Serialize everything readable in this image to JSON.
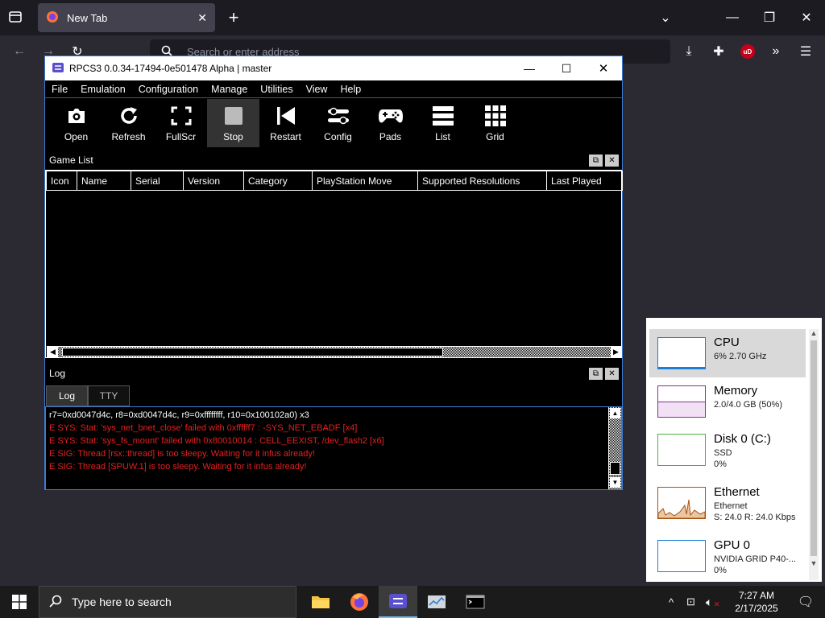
{
  "browser": {
    "tab_title": "New Tab",
    "address_placeholder": "Search or enter address",
    "extension_badge": "uD"
  },
  "rpcs3": {
    "window_title": "RPCS3 0.0.34-17494-0e501478 Alpha | master",
    "menu": [
      "File",
      "Emulation",
      "Configuration",
      "Manage",
      "Utilities",
      "View",
      "Help"
    ],
    "toolbar": [
      {
        "label": "Open",
        "icon": "camera-icon"
      },
      {
        "label": "Refresh",
        "icon": "refresh-icon"
      },
      {
        "label": "FullScr",
        "icon": "fullscreen-icon"
      },
      {
        "label": "Stop",
        "icon": "stop-icon"
      },
      {
        "label": "Restart",
        "icon": "restart-icon"
      },
      {
        "label": "Config",
        "icon": "config-icon"
      },
      {
        "label": "Pads",
        "icon": "gamepad-icon"
      },
      {
        "label": "List",
        "icon": "list-icon"
      },
      {
        "label": "Grid",
        "icon": "grid-icon"
      }
    ],
    "game_list": {
      "title": "Game List",
      "columns": [
        "Icon",
        "Name",
        "Serial",
        "Version",
        "Category",
        "PlayStation Move",
        "Supported Resolutions",
        "Last Played"
      ]
    },
    "log": {
      "title": "Log",
      "tabs": [
        "Log",
        "TTY"
      ],
      "lines": [
        {
          "text": "r7=0xd0047d4c, r8=0xd0047d4c, r9=0xffffffff, r10=0x100102a0) x3",
          "color": "#ffffff"
        },
        {
          "text": "E SYS: Stat: 'sys_net_bnet_close' failed with 0xffffff7 : -SYS_NET_EBADF [x4]",
          "color": "#e32020"
        },
        {
          "text": "E SYS: Stat: 'sys_fs_mount' failed with 0x80010014 : CELL_EEXIST, /dev_flash2 [x6]",
          "color": "#e32020"
        },
        {
          "text": "E SIG: Thread [rsx::thread] is too sleepy. Waiting for it infus already!",
          "color": "#e32020"
        },
        {
          "text": "E SIG: Thread [SPUW.1] is too sleepy. Waiting for it infus already!",
          "color": "#e32020"
        }
      ]
    }
  },
  "perf": {
    "items": [
      {
        "name": "CPU",
        "line1": "6%  2.70 GHz",
        "line2": "",
        "color": "#1b7fd8",
        "selected": true
      },
      {
        "name": "Memory",
        "line1": "2.0/4.0 GB (50%)",
        "line2": "",
        "color": "#8b2a9e",
        "selected": false
      },
      {
        "name": "Disk 0 (C:)",
        "line1": "SSD",
        "line2": "0%",
        "color": "#4caf3e",
        "selected": false
      },
      {
        "name": "Ethernet",
        "line1": "Ethernet",
        "line2": "S: 24.0  R: 24.0 Kbps",
        "color": "#a7520f",
        "selected": false
      },
      {
        "name": "GPU 0",
        "line1": "NVIDIA GRID P40-...",
        "line2": "0%",
        "color": "#1b7fd8",
        "selected": false
      }
    ]
  },
  "taskbar": {
    "search_placeholder": "Type here to search",
    "time": "7:27 AM",
    "date": "2/17/2025"
  }
}
